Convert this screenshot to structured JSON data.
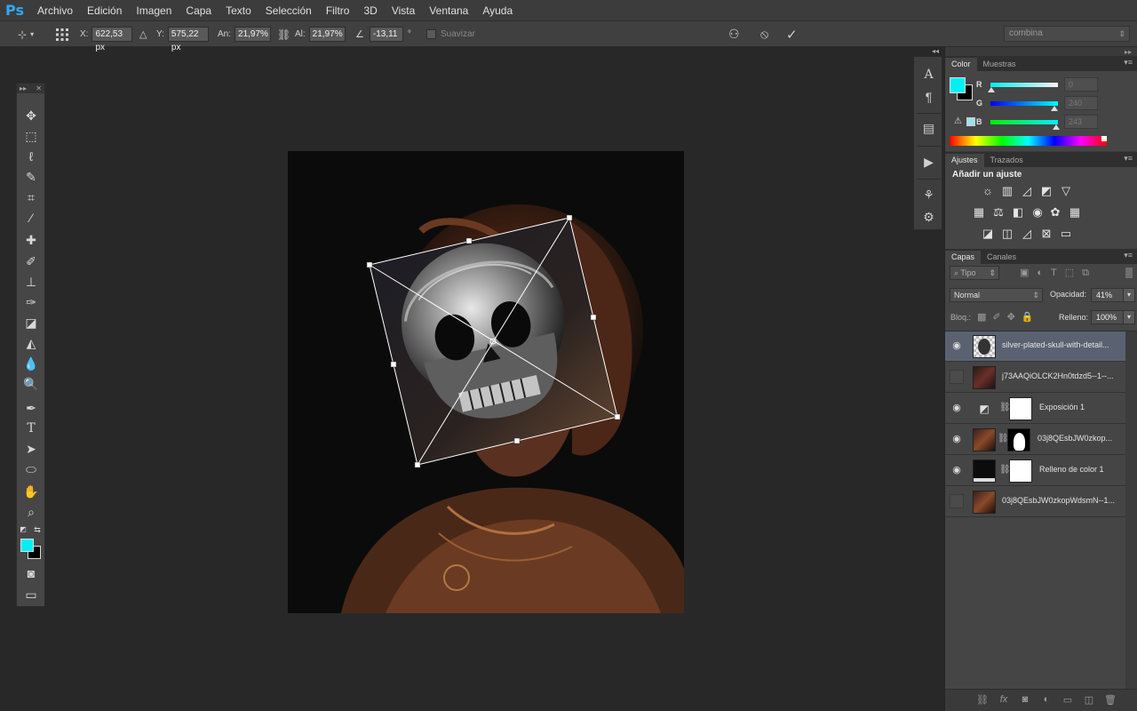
{
  "app": {
    "logo": "Ps"
  },
  "menu": [
    "Archivo",
    "Edición",
    "Imagen",
    "Capa",
    "Texto",
    "Selección",
    "Filtro",
    "3D",
    "Vista",
    "Ventana",
    "Ayuda"
  ],
  "options": {
    "x_label": "X:",
    "x_value": "622,53 px",
    "y_label": "Y:",
    "y_value": "575,22 px",
    "w_label": "An:",
    "w_value": "21,97%",
    "h_label": "Al:",
    "h_value": "21,97%",
    "angle_value": "-13,11",
    "angle_unit": "°",
    "smooth_label": "Suavizar",
    "workspace": "combina"
  },
  "colors": {
    "foreground": "#00f0f3",
    "background": "#000000",
    "accent_blue": "#31a8ff",
    "selected_layer": "#5a6272"
  },
  "color_panel": {
    "tabs": [
      "Color",
      "Muestras"
    ],
    "r_label": "R",
    "r_value": "0",
    "g_label": "G",
    "g_value": "240",
    "b_label": "B",
    "b_value": "243"
  },
  "adjustments_panel": {
    "tabs": [
      "Ajustes",
      "Trazados"
    ],
    "heading": "Añadir un ajuste"
  },
  "layers_panel": {
    "tabs": [
      "Capas",
      "Canales"
    ],
    "filter_kind": "Tipo",
    "blend_mode": "Normal",
    "opacity_label": "Opacidad:",
    "opacity_value": "41%",
    "lock_label": "Bloq.:",
    "fill_label": "Relleno:",
    "fill_value": "100%",
    "layers": [
      {
        "name": "silver-plated-skull-with-detail...",
        "visible": true,
        "selected": true
      },
      {
        "name": "j73AAQiOLCK2Hn0tdzd5--1--...",
        "visible": false,
        "selected": false
      },
      {
        "name": "Exposición 1",
        "visible": true,
        "selected": false
      },
      {
        "name": "03j8QEsbJW0zkop...",
        "visible": true,
        "selected": false
      },
      {
        "name": "Relleno de color 1",
        "visible": true,
        "selected": false
      },
      {
        "name": "03j8QEsbJW0zkopWdsmN--1...",
        "visible": false,
        "selected": false
      }
    ]
  }
}
